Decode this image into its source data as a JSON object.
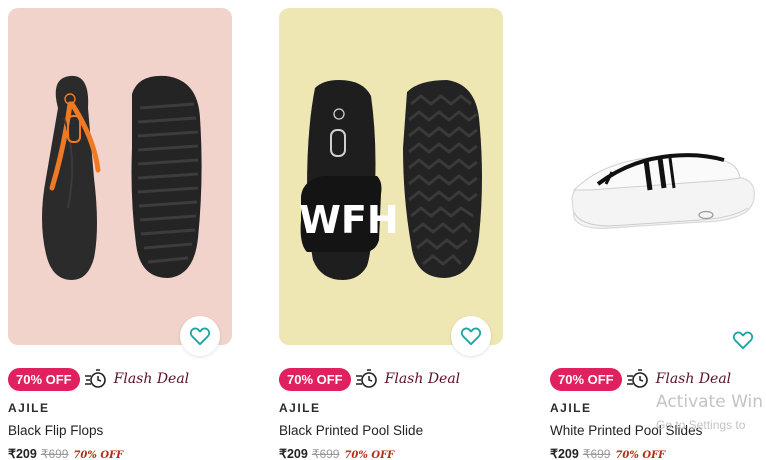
{
  "products": [
    {
      "discount_badge": "70% OFF",
      "deal_label": "Flash Deal",
      "brand": "AJILE",
      "name": "Black Flip Flops",
      "price": "₹209",
      "mrp": "₹699",
      "discount_text": "70% OFF",
      "image_bg": "#f1d3cc",
      "wishlist_icon": "heart-icon"
    },
    {
      "discount_badge": "70% OFF",
      "deal_label": "Flash Deal",
      "brand": "AJILE",
      "name": "Black Printed Pool Slide",
      "price": "₹209",
      "mrp": "₹699",
      "discount_text": "70% OFF",
      "image_bg": "#eee7b4",
      "slide_print": "WFH",
      "wishlist_icon": "heart-icon"
    },
    {
      "discount_badge": "70% OFF",
      "deal_label": "Flash Deal",
      "brand": "AJILE",
      "name": "White Printed Pool Slides",
      "price": "₹209",
      "mrp": "₹699",
      "discount_text": "70% OFF",
      "image_bg": "#ffffff",
      "wishlist_icon": "heart-icon"
    }
  ],
  "colors": {
    "badge_bg": "#e1205f",
    "wishlist_accent": "#1aa7a3",
    "flash_text": "#5a1028",
    "discount_text": "#b22b12"
  },
  "watermark": {
    "line1": "Activate Win",
    "line2": "Go to Settings to"
  }
}
